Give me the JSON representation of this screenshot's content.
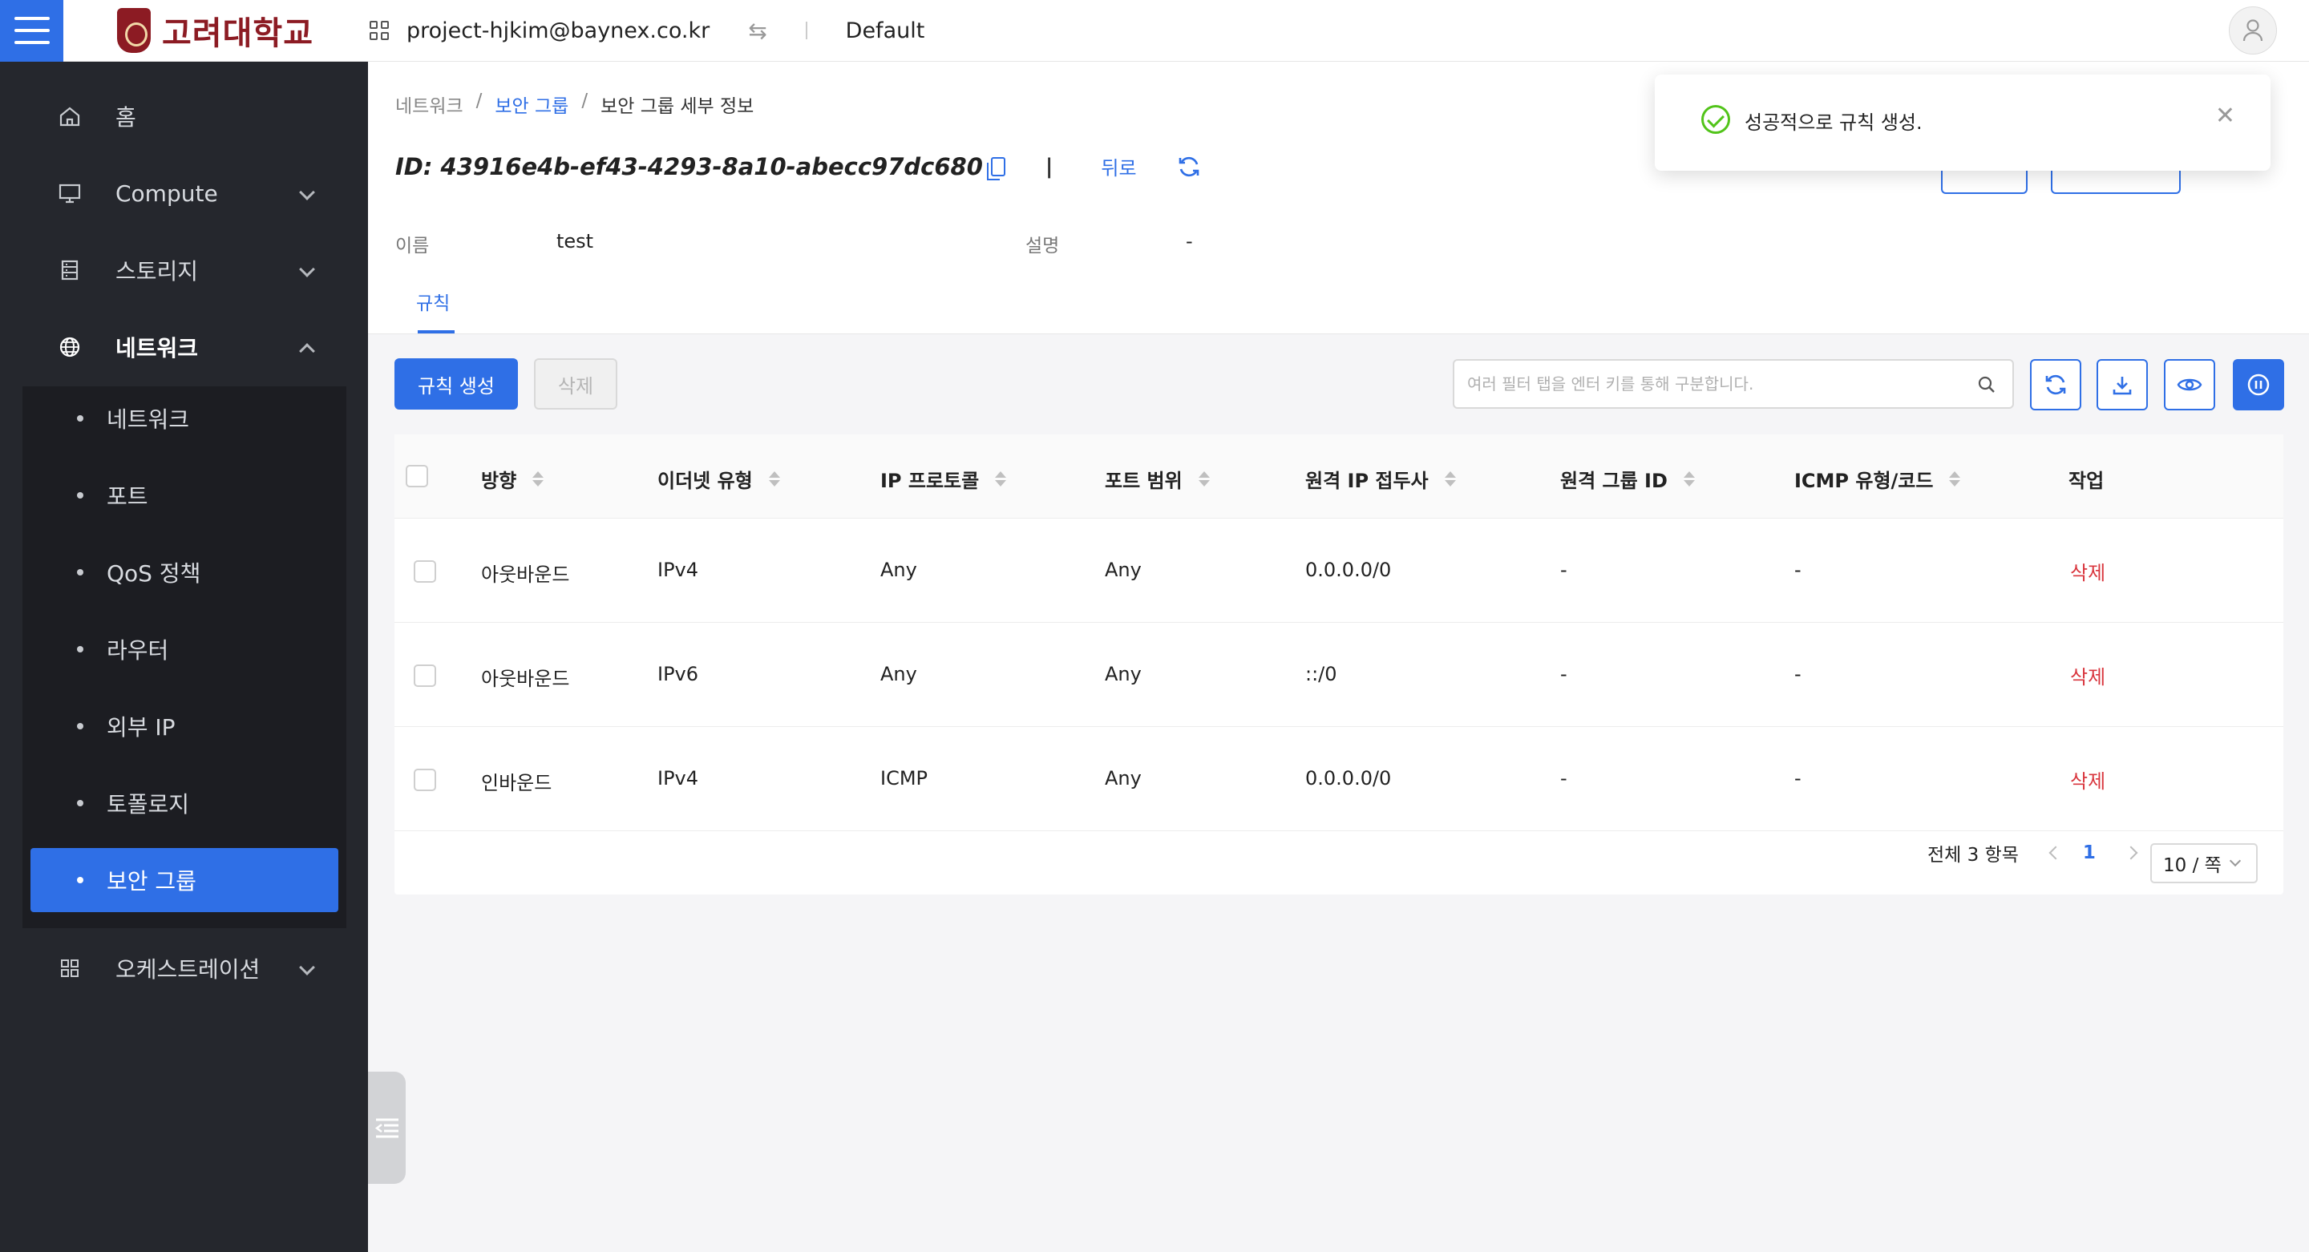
{
  "header": {
    "logo_text": "고려대학교",
    "project": "project-hjkim@baynex.co.kr",
    "domain": "Default"
  },
  "sidebar": {
    "items": [
      {
        "label": "홈",
        "icon": "home-icon"
      },
      {
        "label": "Compute",
        "icon": "monitor-icon"
      },
      {
        "label": "스토리지",
        "icon": "storage-icon"
      },
      {
        "label": "네트워크",
        "icon": "globe-icon"
      },
      {
        "label": "오케스트레이션",
        "icon": "apps-icon"
      }
    ],
    "network_sub": [
      {
        "label": "네트워크"
      },
      {
        "label": "포트"
      },
      {
        "label": "QoS 정책"
      },
      {
        "label": "라우터"
      },
      {
        "label": "외부 IP"
      },
      {
        "label": "토폴로지"
      },
      {
        "label": "보안 그룹"
      }
    ]
  },
  "breadcrumb": {
    "root": "네트워크",
    "sep": "/",
    "parent": "보안 그룹",
    "current": "보안 그룹 세부 정보"
  },
  "detail": {
    "id": "ID: 43916e4b-ef43-4293-8a10-abecc97dc680",
    "divider": "|",
    "back_label": "뒤로",
    "name_label": "이름",
    "name_value": "test",
    "desc_label": "설명",
    "desc_value": "-"
  },
  "tabs": [
    {
      "label": "규칙"
    }
  ],
  "toolbar": {
    "create_label": "규칙 생성",
    "delete_label": "삭제",
    "search_placeholder": "여러 필터 탭을 엔터 키를 통해 구분합니다."
  },
  "table": {
    "columns": [
      "방향",
      "이더넷 유형",
      "IP 프로토콜",
      "포트 범위",
      "원격 IP 접두사",
      "원격 그룹 ID",
      "ICMP 유형/코드",
      "작업"
    ],
    "rows": [
      {
        "direction": "아웃바운드",
        "ethertype": "IPv4",
        "protocol": "Any",
        "port": "Any",
        "remote_ip": "0.0.0.0/0",
        "remote_group": "-",
        "icmp": "-",
        "action": "삭제"
      },
      {
        "direction": "아웃바운드",
        "ethertype": "IPv6",
        "protocol": "Any",
        "port": "Any",
        "remote_ip": "::/0",
        "remote_group": "-",
        "icmp": "-",
        "action": "삭제"
      },
      {
        "direction": "인바운드",
        "ethertype": "IPv4",
        "protocol": "ICMP",
        "port": "Any",
        "remote_ip": "0.0.0.0/0",
        "remote_group": "-",
        "icmp": "-",
        "action": "삭제"
      }
    ]
  },
  "pagination": {
    "total": "전체 3 항목",
    "current_page": "1",
    "page_size": "10 / 쪽"
  },
  "toast": {
    "message": "성공적으로 규칙 생성."
  },
  "colors": {
    "primary": "#2f6fe6",
    "sidebar": "#25272d",
    "danger": "#d9363e",
    "success": "#52c41a"
  }
}
